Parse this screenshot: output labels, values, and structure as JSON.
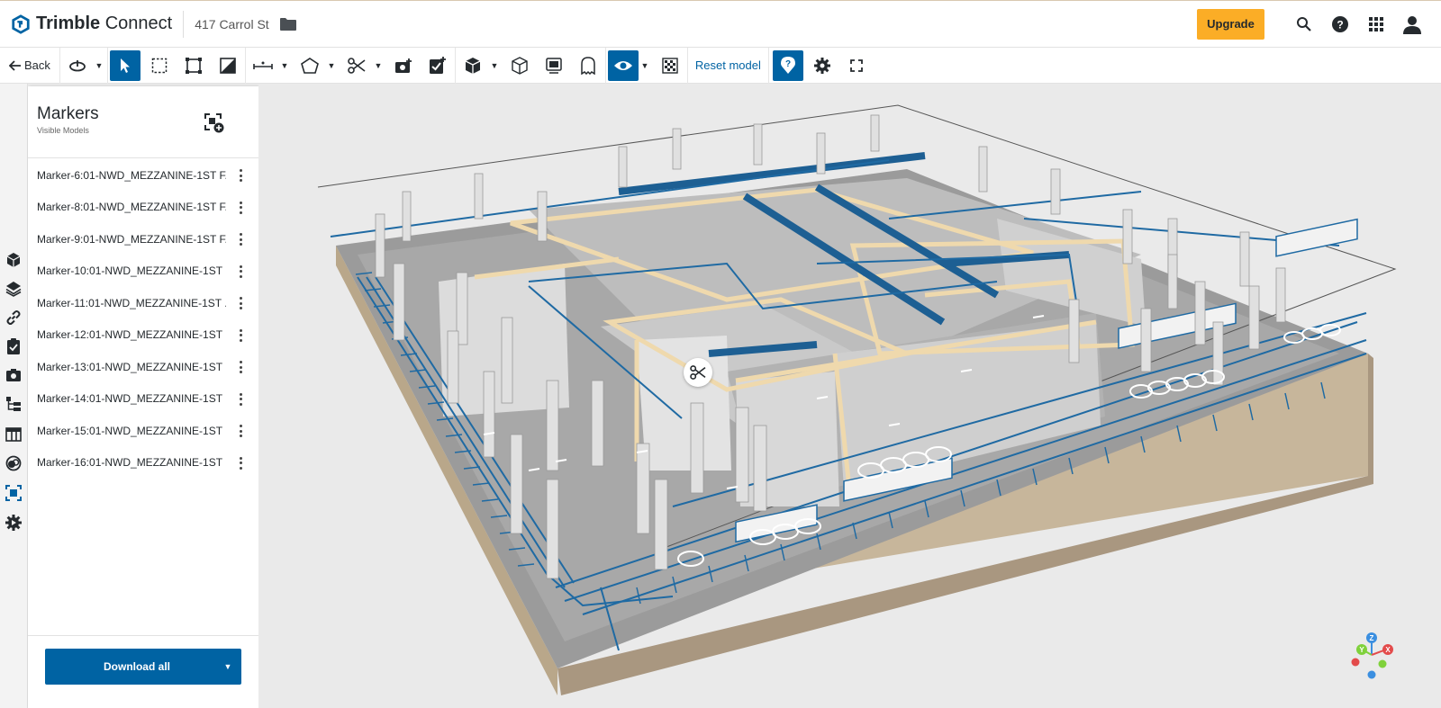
{
  "app": {
    "brand_bold": "Trimble",
    "brand_light": " Connect",
    "project_name": "417 Carrol St"
  },
  "header": {
    "upgrade_label": "Upgrade",
    "icons": [
      "search-icon",
      "help-icon",
      "apps-grid-icon",
      "user-avatar-icon"
    ]
  },
  "toolbar": {
    "back_label": "Back",
    "reset_model_label": "Reset model",
    "accent_color": "#0063a3"
  },
  "panel": {
    "title": "Markers",
    "subtitle": "Visible Models",
    "markers": [
      {
        "label": "Marker-6:01-NWD_MEZZANINE-1ST F..."
      },
      {
        "label": "Marker-8:01-NWD_MEZZANINE-1ST F..."
      },
      {
        "label": "Marker-9:01-NWD_MEZZANINE-1ST F..."
      },
      {
        "label": "Marker-10:01-NWD_MEZZANINE-1ST ..."
      },
      {
        "label": "Marker-11:01-NWD_MEZZANINE-1ST ..."
      },
      {
        "label": "Marker-12:01-NWD_MEZZANINE-1ST ..."
      },
      {
        "label": "Marker-13:01-NWD_MEZZANINE-1ST ..."
      },
      {
        "label": "Marker-14:01-NWD_MEZZANINE-1ST ..."
      },
      {
        "label": "Marker-15:01-NWD_MEZZANINE-1ST ..."
      },
      {
        "label": "Marker-16:01-NWD_MEZZANINE-1ST ..."
      }
    ],
    "download_label": "Download all"
  },
  "nav_cube": {
    "axis_x": "X",
    "axis_y": "Y",
    "axis_z": "Z"
  }
}
